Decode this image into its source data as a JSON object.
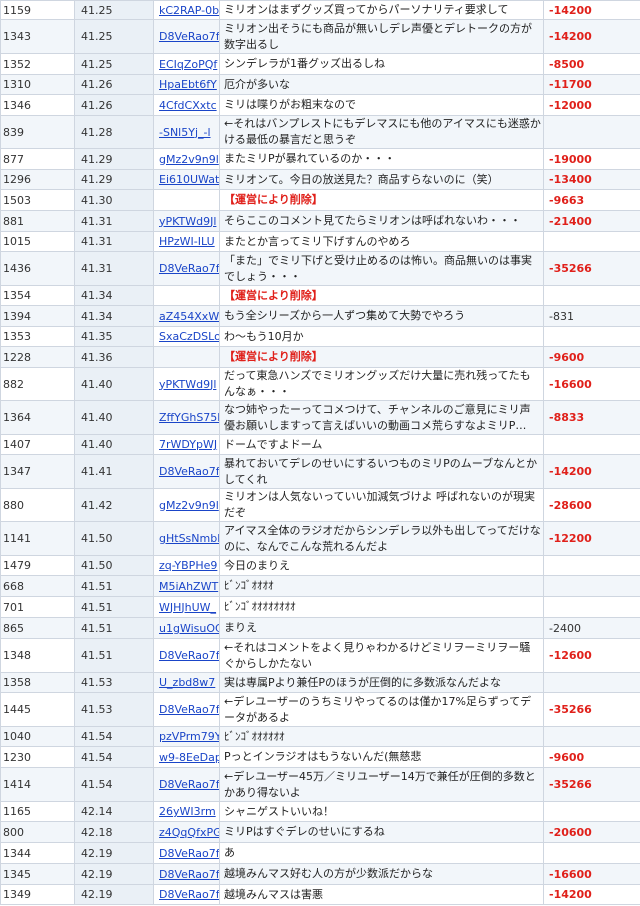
{
  "rows": [
    {
      "no": "1159",
      "time": "41.25",
      "id": "kC2RAP-0b",
      "msg": "ミリオンはまずグッズ買ってからパーソナリティ要求して",
      "score": "-14200",
      "neg": true,
      "h": 19
    },
    {
      "no": "1343",
      "time": "41.25",
      "id": "D8VeRao7f",
      "msg": "ミリオン出そうにも商品が無いしデレ声優とデレトークの方が数字出るし",
      "score": "-14200",
      "neg": true,
      "h": 34
    },
    {
      "no": "1352",
      "time": "41.25",
      "id": "ECIqZoPQf",
      "msg": "シンデレラが1番グッズ出るしね",
      "score": "-8500",
      "neg": true,
      "h": 21
    },
    {
      "no": "1310",
      "time": "41.26",
      "id": "HpaEbt6fY",
      "msg": "厄介が多いな",
      "score": "-11700",
      "neg": true,
      "h": 20
    },
    {
      "no": "1346",
      "time": "41.26",
      "id": "4CfdCXxtc",
      "msg": "ミリは喋りがお粗末なので",
      "score": "-12000",
      "neg": true,
      "h": 21
    },
    {
      "no": "839",
      "time": "41.28",
      "id": "-SNl5Yj_-l",
      "msg": "←それはバンプレストにもデレマスにも他のアイマスにも迷惑かける最低の暴言だと思うぞ",
      "score": "",
      "neg": false,
      "h": 32
    },
    {
      "no": "877",
      "time": "41.29",
      "id": "gMz2v9n9l",
      "msg": "またミリPが暴れているのか・・・",
      "score": "-19000",
      "neg": true,
      "h": 21
    },
    {
      "no": "1296",
      "time": "41.29",
      "id": "Ei610UWat",
      "msg": "ミリオンて。今日の放送見た？商品すらないのに（笑）",
      "score": "-13400",
      "neg": true,
      "h": 20
    },
    {
      "no": "1503",
      "time": "41.30",
      "id": "",
      "msg": "【運営により削除】",
      "del": true,
      "score": "-9663",
      "neg": true,
      "h": 21
    },
    {
      "no": "881",
      "time": "41.31",
      "id": "yPKTWd9Jl",
      "msg": "そらここのコメント見てたらミリオンは呼ばれないわ・・・",
      "score": "-21400",
      "neg": true,
      "h": 21
    },
    {
      "no": "1015",
      "time": "41.31",
      "id": "HPzWI-ILU",
      "msg": "またとか言ってミリ下げすんのやめろ",
      "score": "",
      "neg": false,
      "h": 20
    },
    {
      "no": "1436",
      "time": "41.31",
      "id": "D8VeRao7f",
      "msg": "「また」でミリ下げと受け止めるのは怖い。商品無いのは事実でしょう・・・",
      "score": "-35266",
      "neg": true,
      "h": 34
    },
    {
      "no": "1354",
      "time": "41.34",
      "id": "",
      "msg": "【運営により削除】",
      "del": true,
      "score": "",
      "neg": false,
      "h": 20
    },
    {
      "no": "1394",
      "time": "41.34",
      "id": "aZ454XxW",
      "msg": "もう全シリーズから一人ずつ集めて大勢でやろう",
      "score": "-831",
      "neg": false,
      "h": 21
    },
    {
      "no": "1353",
      "time": "41.35",
      "id": "SxaCzDSLo",
      "msg": "わ～もう10月か",
      "score": "",
      "neg": false,
      "h": 20
    },
    {
      "no": "1228",
      "time": "41.36",
      "id": "",
      "msg": "【運営により削除】",
      "del": true,
      "score": "-9600",
      "neg": true,
      "h": 21
    },
    {
      "no": "882",
      "time": "41.40",
      "id": "yPKTWd9Jl",
      "msg": "だって東急ハンズでミリオングッズだけ大量に売れ残ってたもんなぁ・・・",
      "score": "-16600",
      "neg": true,
      "h": 33
    },
    {
      "no": "1364",
      "time": "41.40",
      "id": "ZffYGhS75l",
      "msg": "なつ姉やったーってコメつけて、チャンネルのご意見にミリ声優お願いしますって言えばいいの動画コメ荒らすなよミリP…",
      "score": "-8833",
      "neg": true,
      "h": 34
    },
    {
      "no": "1407",
      "time": "41.40",
      "id": "7rWDYpWJ",
      "msg": "ドームですよドーム",
      "score": "",
      "neg": false,
      "h": 20
    },
    {
      "no": "1347",
      "time": "41.41",
      "id": "D8VeRao7f",
      "msg": "暴れておいてデレのせいにするいつものミリPのムーブなんとかしてくれ",
      "score": "-14200",
      "neg": true,
      "h": 34
    },
    {
      "no": "880",
      "time": "41.42",
      "id": "gMz2v9n9l",
      "msg": "ミリオンは人気ないっていい加減気づけよ 呼ばれないのが現実だぞ",
      "score": "-28600",
      "neg": true,
      "h": 33
    },
    {
      "no": "1141",
      "time": "41.50",
      "id": "gHtSsNmbl",
      "msg": "アイマス全体のラジオだからシンデレラ以外も出してってだけなのに、なんでこんな荒れるんだよ",
      "score": "-12200",
      "neg": true,
      "h": 34
    },
    {
      "no": "1479",
      "time": "41.50",
      "id": "zq-YBPHe9",
      "msg": "今日のまりえ",
      "score": "",
      "neg": false,
      "h": 20
    },
    {
      "no": "668",
      "time": "41.51",
      "id": "M5iAhZWT",
      "msg": "ﾋﾞﾝｺﾞｵｵｵｵ",
      "score": "",
      "neg": false,
      "h": 21
    },
    {
      "no": "701",
      "time": "41.51",
      "id": "WJHJhUW_",
      "msg": "ﾋﾞﾝｺﾞｵｵｵｵｵｵｵｵ",
      "score": "",
      "neg": false,
      "h": 21
    },
    {
      "no": "865",
      "time": "41.51",
      "id": "u1gWisuOC",
      "msg": "まりえ",
      "score": "-2400",
      "neg": false,
      "h": 21
    },
    {
      "no": "1348",
      "time": "41.51",
      "id": "D8VeRao7f",
      "msg": "←それはコメントをよく見りゃわかるけどミリヲーミリヲー騒ぐからしかたない",
      "score": "-12600",
      "neg": true,
      "h": 34
    },
    {
      "no": "1358",
      "time": "41.53",
      "id": "U_zbd8w7",
      "msg": "実は専属Pより兼任Pのほうが圧倒的に多数派なんだよな",
      "score": "",
      "neg": false,
      "h": 20
    },
    {
      "no": "1445",
      "time": "41.53",
      "id": "D8VeRao7f",
      "msg": "←デレユーザーのうちミリやってるのは僅か17%足らずってデータがあるよ",
      "score": "-35266",
      "neg": true,
      "h": 34
    },
    {
      "no": "1040",
      "time": "41.54",
      "id": "pzVPrm79Y",
      "msg": "ﾋﾞﾝｺﾞｵｵｵｵｵｵ",
      "score": "",
      "neg": false,
      "h": 20
    },
    {
      "no": "1230",
      "time": "41.54",
      "id": "w9-8EeDap",
      "msg": "Pっとインラジオはもうないんだ(無慈悲",
      "score": "-9600",
      "neg": true,
      "h": 21
    },
    {
      "no": "1414",
      "time": "41.54",
      "id": "D8VeRao7f",
      "msg": "←デレユーザー45万／ミリユーザー14万で兼任が圧倒的多数とかあり得ないよ",
      "score": "-35266",
      "neg": true,
      "h": 34
    },
    {
      "no": "1165",
      "time": "42.14",
      "id": "26yWI3rm",
      "msg": "シャニゲストいいね！",
      "score": "",
      "neg": false,
      "h": 20
    },
    {
      "no": "800",
      "time": "42.18",
      "id": "z4QqQfxPG",
      "msg": "ミリPはすぐデレのせいにするね",
      "score": "-20600",
      "neg": true,
      "h": 21
    },
    {
      "no": "1344",
      "time": "42.19",
      "id": "D8VeRao7f",
      "msg": "あ",
      "score": "",
      "neg": false,
      "h": 21
    },
    {
      "no": "1345",
      "time": "42.19",
      "id": "D8VeRao7f",
      "msg": "越境みんマス好む人の方が少数派だからな",
      "score": "-16600",
      "neg": true,
      "h": 21
    },
    {
      "no": "1349",
      "time": "42.19",
      "id": "D8VeRao7f",
      "msg": "越境みんマスは害悪",
      "score": "-14200",
      "neg": true,
      "h": 20
    }
  ]
}
